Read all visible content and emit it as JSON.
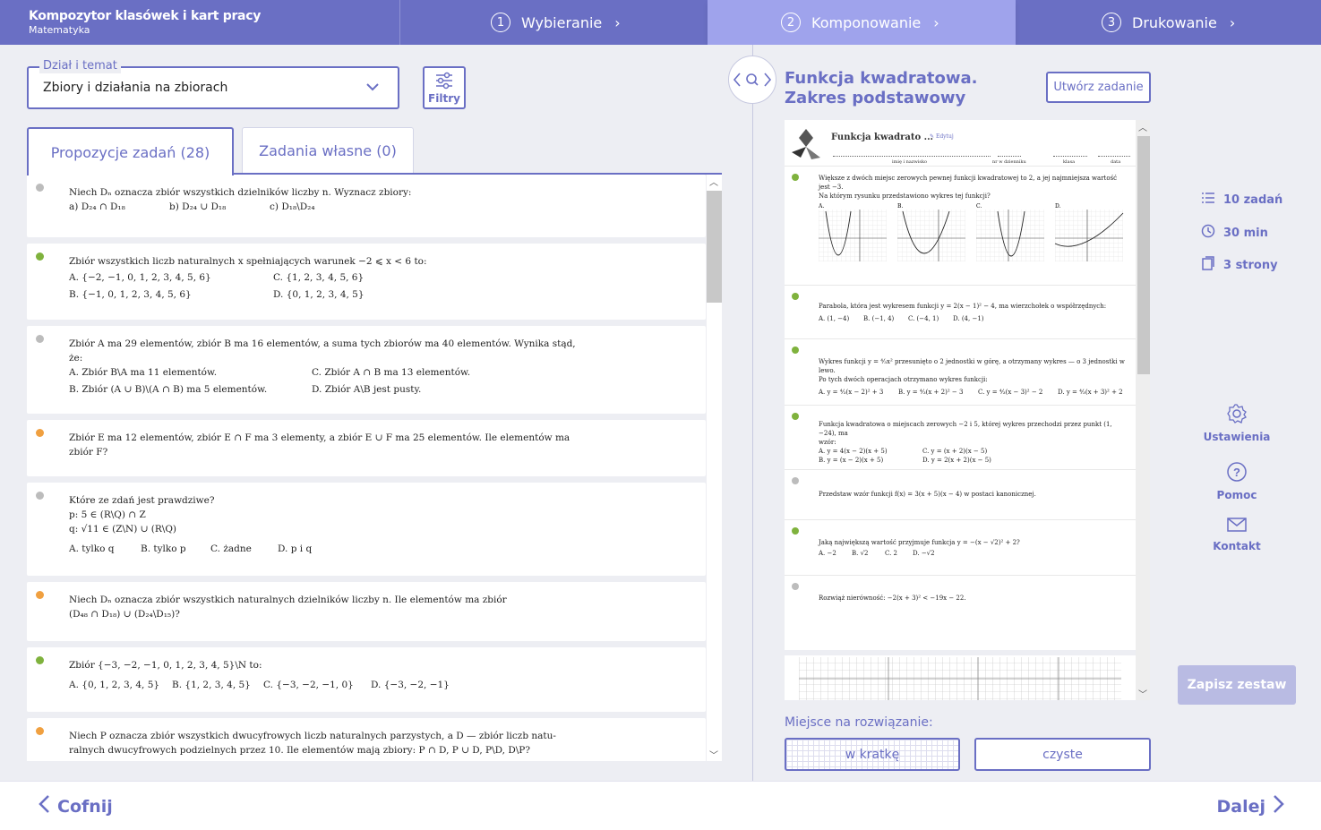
{
  "header": {
    "app_title": "Kompozytor klasówek i kart pracy",
    "app_subtitle": "Matematyka",
    "steps": [
      {
        "num": "1",
        "label": "Wybieranie"
      },
      {
        "num": "2",
        "label": "Komponowanie"
      },
      {
        "num": "3",
        "label": "Drukowanie"
      }
    ],
    "active_step": 2
  },
  "filters": {
    "section_legend": "Dział i temat",
    "section_value": "Zbiory i działania na zbiorach",
    "filter_button": "Filtry"
  },
  "tabs": {
    "proposals": "Propozycje zadań (28)",
    "own": "Zadania własne (0)"
  },
  "tasks": [
    {
      "status": "gray",
      "lines": [
        "Niech Dₙ oznacza zbiór wszystkich dzielników liczby n. Wyznacz zbiory:"
      ],
      "options": [
        "a)  D₂₄ ∩ D₁₈",
        "b)  D₂₄ ∪ D₁₈",
        "c)  D₁₈\\D₂₄"
      ]
    },
    {
      "status": "green",
      "lines": [
        "Zbiór wszystkich liczb naturalnych x spełniających warunek −2 ⩽ x < 6 to:"
      ],
      "options": [
        "A. {−2, −1, 0, 1, 2, 3, 4, 5, 6}",
        "C. {1, 2, 3, 4, 5, 6}",
        "B. {−1, 0, 1, 2, 3, 4, 5, 6}",
        "D. {0, 1, 2, 3, 4, 5}"
      ]
    },
    {
      "status": "gray",
      "lines": [
        "Zbiór A ma 29 elementów, zbiór B ma 16 elementów, a suma tych zbiorów ma 40 elementów. Wynika stąd,",
        "że:"
      ],
      "options": [
        "A. Zbiór B\\A ma 11 elementów.",
        "C. Zbiór A ∩ B ma 13 elementów.",
        "B. Zbiór (A ∪ B)\\(A ∩ B) ma 5 elementów.",
        "D. Zbiór A\\B jest pusty."
      ]
    },
    {
      "status": "orange",
      "lines": [
        "Zbiór E ma 12 elementów, zbiór E ∩ F ma 3 elementy, a zbiór E ∪ F ma 25 elementów. Ile elementów ma",
        "zbiór F?"
      ],
      "options": []
    },
    {
      "status": "gray",
      "lines": [
        "Które ze zdań jest prawdziwe?",
        "p: 5 ∈ (R\\Q) ∩ Z",
        "q: √11 ∈ (Z\\N) ∪ (R\\Q)"
      ],
      "options": [
        "A. tylko q",
        "B. tylko p",
        "C. żadne",
        "D. p i q"
      ]
    },
    {
      "status": "orange",
      "lines": [
        "Niech Dₙ oznacza zbiór wszystkich naturalnych dzielników liczby n. Ile elementów ma zbiór",
        "(D₄₈ ∩ D₁₈) ∪ (D₂₄\\D₁₅)?"
      ],
      "options": []
    },
    {
      "status": "green",
      "lines": [
        "Zbiór {−3, −2, −1, 0, 1, 2, 3, 4, 5}\\N to:"
      ],
      "options": [
        "A. {0, 1, 2, 3, 4, 5}",
        "B. {1, 2, 3, 4, 5}",
        "C. {−3, −2, −1, 0}",
        "D. {−3, −2, −1}"
      ]
    },
    {
      "status": "orange",
      "lines": [
        "Niech P oznacza zbiór wszystkich dwucyfrowych liczb naturalnych parzystych, a D — zbiór liczb natu-",
        "ralnych dwucyfrowych podzielnych przez 10. Ile elementów mają zbiory: P ∩ D, P ∪ D, P\\D, D\\P?"
      ],
      "options": []
    }
  ],
  "document": {
    "title_line1": "Funkcja kwadratowa.",
    "title_line2": "Zakres podstawowy",
    "create_button": "Utwórz zadanie",
    "preview": {
      "title": "Funkcja kwadrato ...",
      "edit": "Edytuj",
      "fields": [
        "imię i nazwisko",
        "nr w dzienniku",
        "klasa",
        "data"
      ],
      "tasks": [
        {
          "status": "green",
          "lines": [
            "Większe z dwóch miejsc zerowych pewnej funkcji kwadratowej to 2, a jej najmniejsza wartość jest −3.",
            "Na którym rysunku przedstawiono wykres tej funkcji?"
          ],
          "graph_labels": [
            "A.",
            "B.",
            "C.",
            "D."
          ]
        },
        {
          "status": "green",
          "lines": [
            "Parabola, która jest wykresem funkcji y = 2(x − 1)² − 4, ma wierzchołek o współrzędnych:"
          ],
          "options": [
            "A. (1, −4)",
            "B. (−1, 4)",
            "C. (−4, 1)",
            "D. (4, −1)"
          ]
        },
        {
          "status": "green",
          "lines": [
            "Wykres funkcji y = ⁴⁄₃x² przesunięto o 2 jednostki w górę, a otrzymany wykres — o 3 jednostki w lewo.",
            "Po tych dwóch operacjach otrzymano wykres funkcji:"
          ],
          "options": [
            "A. y = ⁴⁄₃(x − 2)² + 3",
            "B. y = ⁴⁄₃(x + 2)² − 3",
            "C. y = ⁴⁄₃(x − 3)² − 2",
            "D. y = ⁴⁄₃(x + 3)² + 2"
          ]
        },
        {
          "status": "green",
          "lines": [
            "Funkcja kwadratowa o miejscach zerowych −2 i 5, której wykres przechodzi przez punkt (1, −24), ma",
            "wzór:"
          ],
          "options": [
            "A. y = 4(x − 2)(x + 5)",
            "C. y = (x + 2)(x − 5)",
            "B. y = (x − 2)(x + 5)",
            "D. y = 2(x + 2)(x − 5)"
          ]
        },
        {
          "status": "gray",
          "lines": [
            "Przedstaw wzór funkcji f(x) = 3(x + 5)(x − 4) w postaci kanonicznej."
          ],
          "options": []
        },
        {
          "status": "green",
          "lines": [
            "Jaką największą wartość przyjmuje funkcja y = −(x − √2)² + 2?"
          ],
          "options": [
            "A. −2",
            "B. √2",
            "C. 2",
            "D. −√2"
          ]
        },
        {
          "status": "gray",
          "lines": [
            "Rozwiąż nierówność:  −2(x + 3)² < −19x − 22."
          ],
          "options": []
        }
      ]
    },
    "solution_label": "Miejsce na rozwiązanie:",
    "solution_grid": "w kratkę",
    "solution_clean": "czyste"
  },
  "stats": {
    "tasks": "10 zadań",
    "time": "30 min",
    "pages": "3 strony"
  },
  "side": {
    "settings": "Ustawienia",
    "help": "Pomoc",
    "contact": "Kontakt",
    "save": "Zapisz zestaw"
  },
  "footer": {
    "back": "Cofnij",
    "next": "Dalej"
  },
  "colors": {
    "accent": "#6a6fc4",
    "active_step": "#9fa3ec",
    "status_green": "#7fb23d",
    "status_orange": "#f0a040",
    "status_gray": "#bcbcbc"
  }
}
